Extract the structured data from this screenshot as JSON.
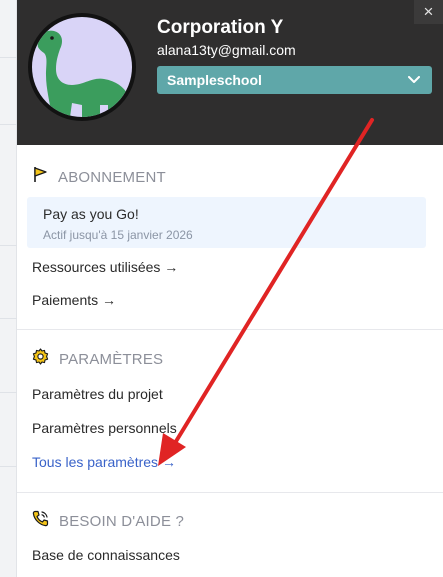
{
  "header": {
    "org_name": "Corporation Y",
    "email": "alana13ty@gmail.com",
    "school_selector": "Sampleschool",
    "close_icon": "close-icon",
    "avatar_icon": "dinosaur-avatar-icon"
  },
  "subscription": {
    "heading": "ABONNEMENT",
    "icon": "flag-icon",
    "plan_name": "Pay as you Go!",
    "valid_until": "Actif jusqu'à 15 janvier 2026",
    "links": [
      "Ressources utilisées →",
      "Paiements →"
    ]
  },
  "settings": {
    "heading": "PARAMÈTRES",
    "icon": "gear-icon",
    "links": [
      "Paramètres du projet",
      "Paramètres personnels",
      "Tous les paramètres →"
    ]
  },
  "help": {
    "heading": "BESOIN D'AIDE ?",
    "icon": "phone-icon",
    "links": [
      "Base de connaissances"
    ]
  },
  "colors": {
    "header_bg": "#2f2e2e",
    "accent_teal": "#5fa7a9",
    "link_blue": "#3a63c9",
    "annotation_red": "#e02424"
  }
}
